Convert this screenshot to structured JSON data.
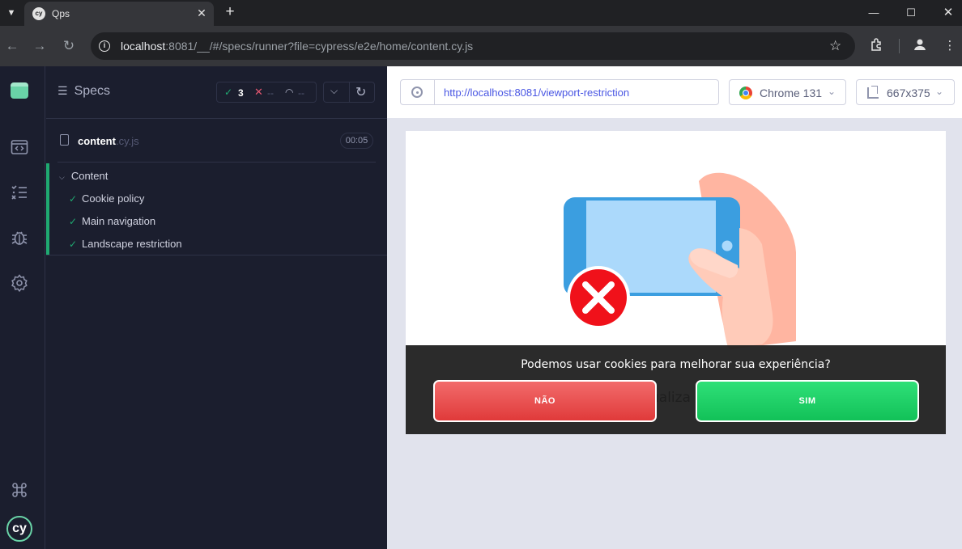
{
  "browser": {
    "tab_title": "Qps",
    "tab_favicon": "cy",
    "url_host": "localhost",
    "url_rest": ":8081/__/#/specs/runner?file=cypress/e2e/home/content.cy.js",
    "icons": [
      "tab-search-icon",
      "close-icon",
      "new-tab-icon",
      "back-icon",
      "forward-icon",
      "reload-icon",
      "site-info-icon",
      "star-icon",
      "extensions-icon",
      "profile-icon",
      "menu-icon",
      "minimize-icon",
      "maximize-icon",
      "window-close-icon"
    ]
  },
  "sidenav": {
    "icons": [
      "app-logo-icon",
      "runs-icon",
      "specs-list-icon",
      "debug-icon",
      "settings-icon",
      "keyboard-shortcuts-icon",
      "cypress-logo-icon"
    ],
    "logo_text": "cy"
  },
  "reporter": {
    "specs_label": "Specs",
    "passed": "3",
    "failed": "--",
    "pending": "--",
    "spec_name": "content",
    "spec_ext": ".cy.js",
    "duration": "00:05",
    "suite_title": "Content",
    "tests": [
      {
        "title": "Cookie policy",
        "state": "passed"
      },
      {
        "title": "Main navigation",
        "state": "passed"
      },
      {
        "title": "Landscape restriction",
        "state": "passed"
      }
    ]
  },
  "aut": {
    "url": "http://localhost:8081/viewport-restriction",
    "browser": "Chrome 131",
    "viewport": "667x375"
  },
  "site": {
    "partial_text": "ualiza",
    "cookie_message": "Podemos usar cookies para melhorar sua experiência?",
    "btn_no": "NÃO",
    "btn_yes": "SIM",
    "colors": {
      "no": "#e83f3f",
      "yes": "#17c95c",
      "bar": "#2a2a2a",
      "phone": "#3b9ee0",
      "error": "#f0111a"
    }
  }
}
